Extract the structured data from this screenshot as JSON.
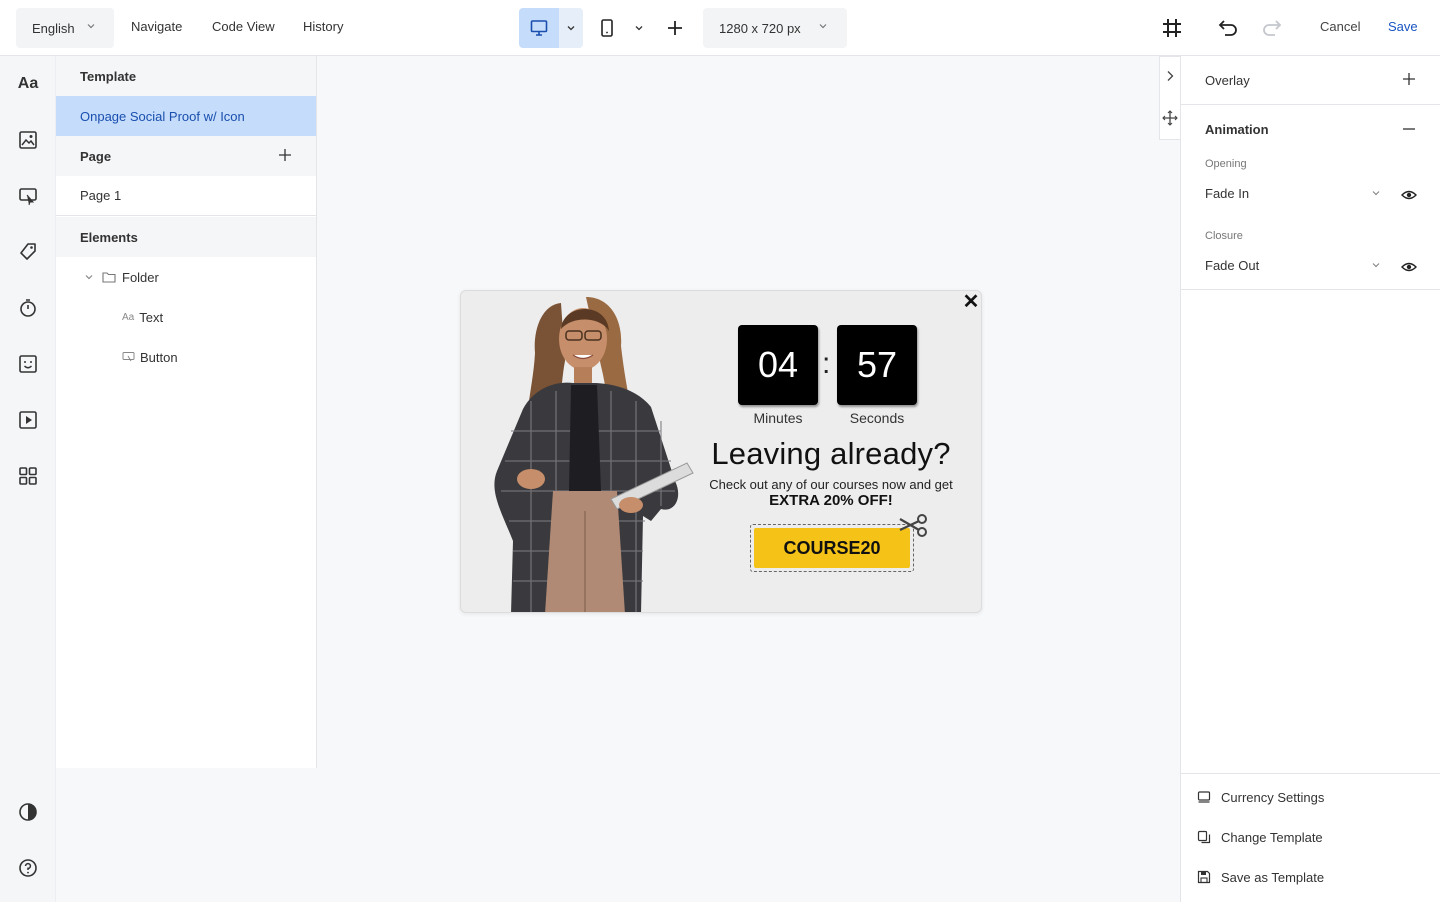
{
  "topbar": {
    "language": "English",
    "nav": [
      "Navigate",
      "Code View",
      "History"
    ],
    "canvas_size": "1280 x 720 px",
    "cancel": "Cancel",
    "save": "Save"
  },
  "layers": {
    "template_header": "Template",
    "template_name": "Onpage Social Proof w/ Icon",
    "page_header": "Page",
    "page_item": "Page 1",
    "elements_header": "Elements",
    "tree": [
      {
        "label": "Folder",
        "icon": "folder-icon"
      },
      {
        "label": "Text",
        "icon": "text-icon"
      },
      {
        "label": "Button",
        "icon": "button-icon"
      }
    ]
  },
  "popup": {
    "minutes": "04",
    "seconds": "57",
    "minutes_label": "Minutes",
    "seconds_label": "Seconds",
    "headline": "Leaving already?",
    "subtext": "Check out any of our courses now and get",
    "offer": "EXTRA 20% OFF!",
    "coupon": "COURSE20",
    "colors": {
      "coupon_bg": "#f5c317",
      "timer_bg": "#000000",
      "popup_bg": "#ededed"
    }
  },
  "right_panel": {
    "overlay_title": "Overlay",
    "animation_title": "Animation",
    "opening_label": "Opening",
    "opening_value": "Fade In",
    "closure_label": "Closure",
    "closure_value": "Fade Out",
    "footer": [
      "Currency Settings",
      "Change Template",
      "Save as Template"
    ]
  },
  "accent": "#1a55c2"
}
